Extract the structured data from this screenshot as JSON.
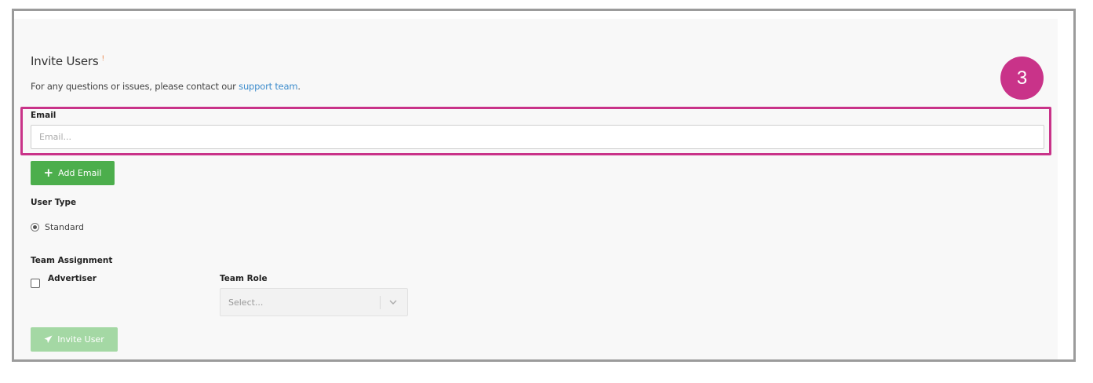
{
  "form": {
    "title": "Invite Users",
    "required_marker": "!",
    "subtitle_prefix": "For any questions or issues, please contact our ",
    "support_link": "support team",
    "subtitle_suffix": ".",
    "email": {
      "label": "Email",
      "placeholder": "Email...",
      "value": ""
    },
    "add_email_button": {
      "label": "Add Email",
      "icon": "plus-icon"
    },
    "user_type": {
      "label": "User Type",
      "options": [
        {
          "label": "Standard",
          "selected": true
        }
      ]
    },
    "team_assignment": {
      "label": "Team Assignment",
      "team": {
        "label": "Advertiser",
        "checked": false
      },
      "team_role": {
        "label": "Team Role",
        "placeholder": "Select..."
      }
    },
    "invite_button": {
      "label": "Invite User",
      "icon": "paper-plane-icon",
      "enabled": false
    }
  },
  "step_badge": "3",
  "colors": {
    "accent_highlight": "#c93389",
    "add_button": "#4cae4c",
    "invite_button_disabled": "#a4d8a4",
    "link": "#3d8ccc",
    "required_marker": "#e8844a"
  }
}
